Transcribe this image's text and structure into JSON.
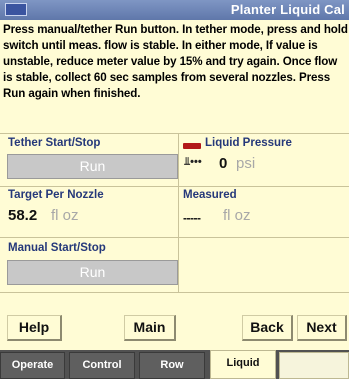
{
  "window": {
    "title": "Planter Liquid Cal"
  },
  "instructions": "Press manual/tether Run button. In tether mode, press and hold switch until meas. flow is stable. In either mode, If value is unstable, reduce meter value by 15% and try again. Once flow is stable, collect 60 sec samples from several nozzles. Press Run again when finished.",
  "tether": {
    "label": "Tether Start/Stop",
    "button": "Run"
  },
  "pressure": {
    "label": "Liquid Pressure",
    "value": "0",
    "unit": "psi"
  },
  "target": {
    "label": "Target Per Nozzle",
    "value": "58.2",
    "unit": "fl oz"
  },
  "measured": {
    "label": "Measured",
    "value": "-----",
    "unit": "fl oz"
  },
  "manual": {
    "label": "Manual Start/Stop",
    "button": "Run"
  },
  "buttons": {
    "help": "Help",
    "main": "Main",
    "back": "Back",
    "next": "Next"
  },
  "tabs": [
    {
      "label": "Operate"
    },
    {
      "label": "Control"
    },
    {
      "label": "Row"
    },
    {
      "label": "Liquid"
    }
  ],
  "icons": {
    "window": "app-menu-icon",
    "pressure": "liquid-pressure-icon",
    "gauge": "pressure-gauge-icon"
  },
  "colors": {
    "background": "#fffcd5",
    "title_bar": "#6f86b8",
    "label_blue": "#25387a",
    "run_disabled": "#c8c8c8",
    "tab_bar": "#515151"
  }
}
